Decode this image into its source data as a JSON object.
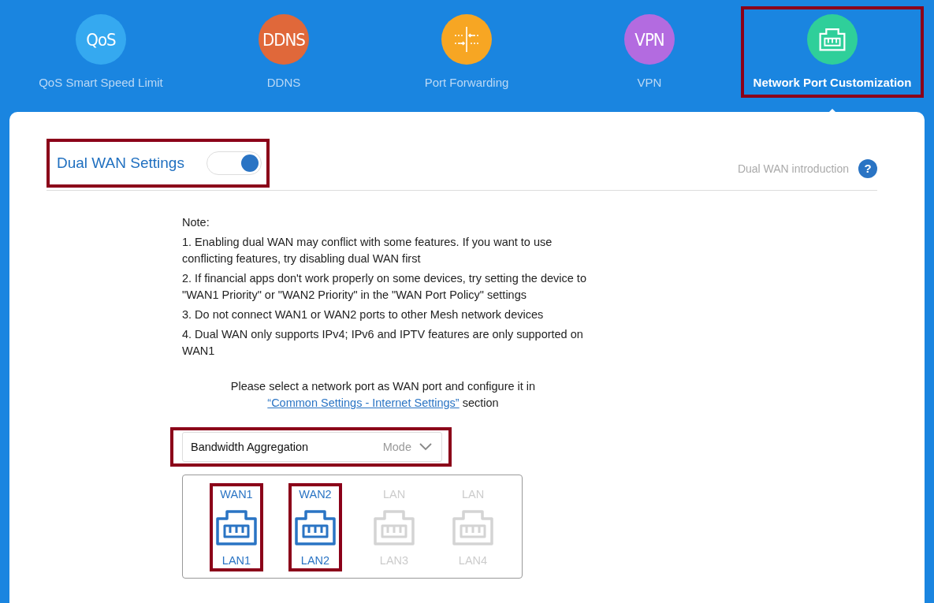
{
  "nav": [
    {
      "label": "QoS Smart Speed Limit",
      "kind": "text",
      "icon_text": "QoS",
      "color": "#35a9f0",
      "selected": false,
      "highlighted": false
    },
    {
      "label": "DDNS",
      "kind": "text",
      "icon_text": "DDNS",
      "color": "#e0683a",
      "selected": false,
      "highlighted": false
    },
    {
      "label": "Port Forwarding",
      "kind": "forwarding",
      "color": "#f7a623",
      "selected": false,
      "highlighted": false
    },
    {
      "label": "VPN",
      "kind": "text",
      "icon_text": "VPN",
      "color": "#b36be0",
      "selected": false,
      "highlighted": false
    },
    {
      "label": "Network Port Customization",
      "kind": "port",
      "color": "#2fcf9a",
      "selected": true,
      "highlighted": true
    }
  ],
  "dual_wan": {
    "title": "Dual WAN Settings",
    "on": true,
    "highlighted": true,
    "help_link": "Dual WAN introduction",
    "help_icon": "?"
  },
  "note": {
    "title": "Note:",
    "items": [
      "1. Enabling dual WAN may conflict with some features. If you want to use conflicting features, try disabling dual WAN first",
      "2. If financial apps don't work properly on some devices, try setting the device to \"WAN1 Priority\" or \"WAN2 Priority\" in the \"WAN Port Policy\" settings",
      "3. Do not connect WAN1 or WAN2 ports to other Mesh network devices",
      "4. Dual WAN only supports IPv4; IPv6 and IPTV features are only supported on WAN1"
    ]
  },
  "instruction": {
    "text_before": "Please select a network port as WAN port and configure it in",
    "link": "“Common Settings - Internet Settings”",
    "text_after": "section"
  },
  "mode_select": {
    "value": "Bandwidth Aggregation",
    "label": "Mode",
    "highlighted": true
  },
  "ports": [
    {
      "top": "WAN1",
      "bottom": "LAN1",
      "active": true,
      "highlighted": true
    },
    {
      "top": "WAN2",
      "bottom": "LAN2",
      "active": true,
      "highlighted": true
    },
    {
      "top": "LAN",
      "bottom": "LAN3",
      "active": false,
      "highlighted": false
    },
    {
      "top": "LAN",
      "bottom": "LAN4",
      "active": false,
      "highlighted": false
    }
  ]
}
